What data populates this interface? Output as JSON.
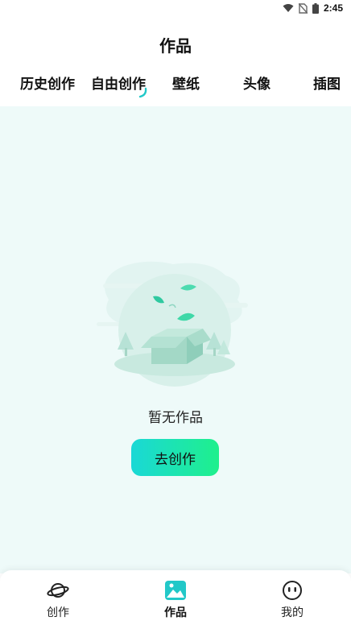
{
  "status_bar": {
    "time": "2:45",
    "icons": [
      "wifi-icon",
      "no-sim-icon",
      "battery-icon"
    ]
  },
  "header": {
    "title": "作品"
  },
  "tabs": [
    {
      "label": "历史创作",
      "active": false
    },
    {
      "label": "自由创作",
      "active": true
    },
    {
      "label": "壁纸",
      "active": false
    },
    {
      "label": "头像",
      "active": false
    },
    {
      "label": "插图",
      "active": false
    }
  ],
  "empty_state": {
    "illustration": "empty-box-icon",
    "message": "暂无作品",
    "button_label": "去创作"
  },
  "bottom_nav": {
    "items": [
      {
        "label": "创作",
        "icon": "planet-icon",
        "active": false
      },
      {
        "label": "作品",
        "icon": "gallery-icon",
        "active": true
      },
      {
        "label": "我的",
        "icon": "profile-icon",
        "active": false
      }
    ]
  },
  "colors": {
    "accent_start": "#1ad8d6",
    "accent_end": "#1ff08c",
    "content_bg": "#eefaf9",
    "indicator": "#22c8c8"
  }
}
